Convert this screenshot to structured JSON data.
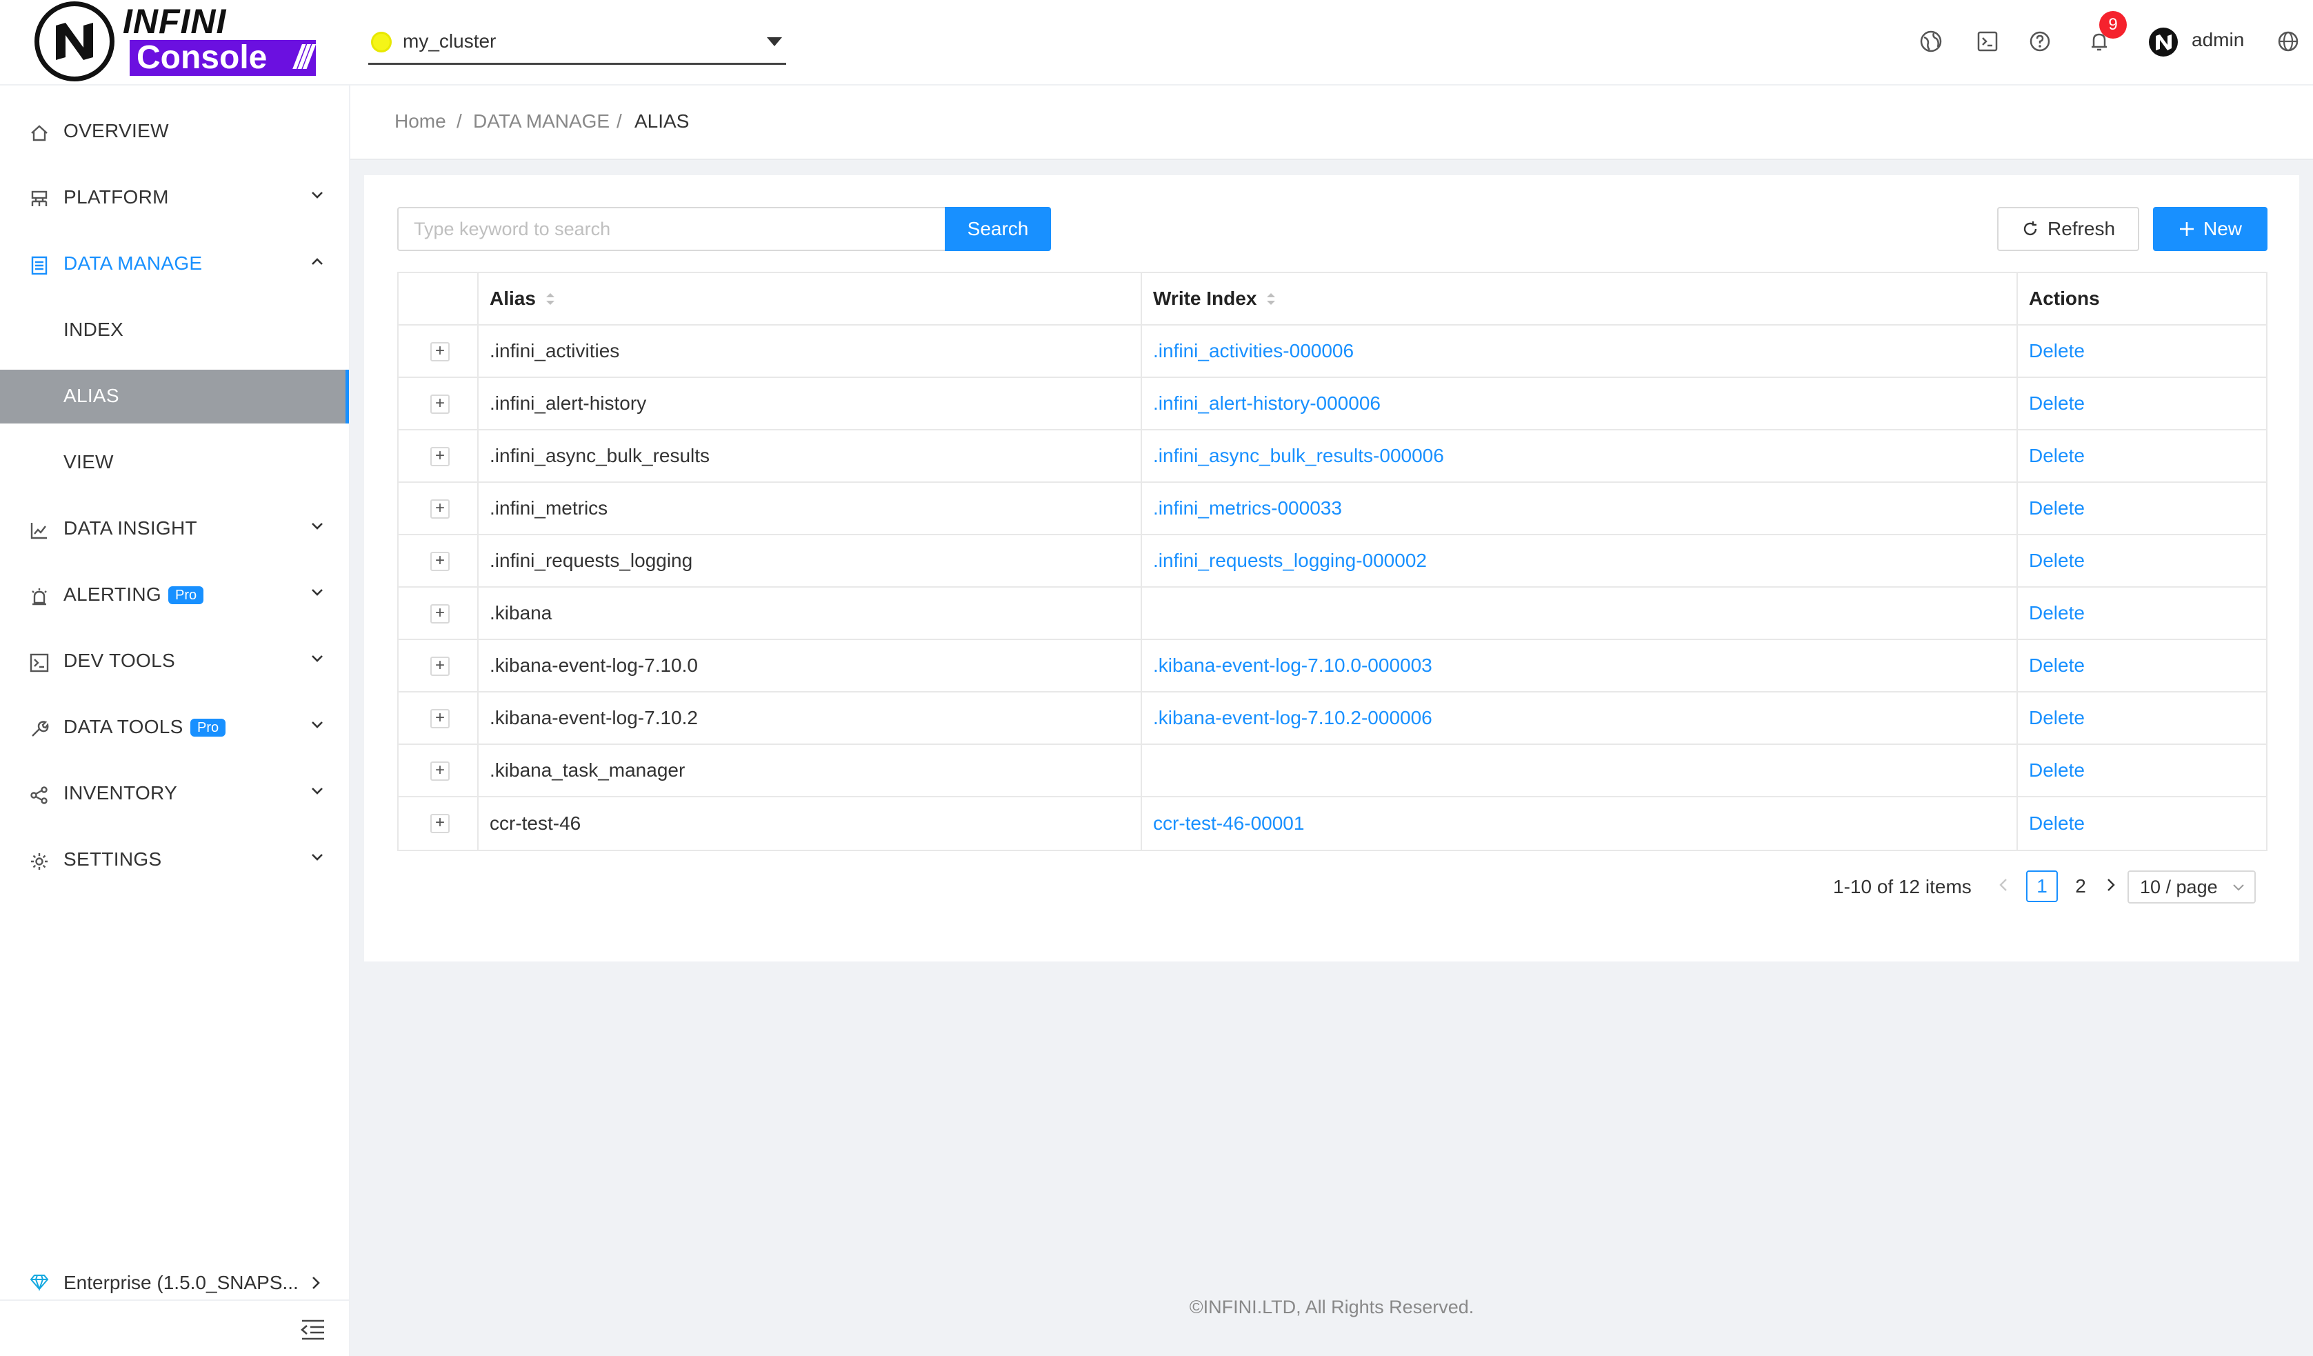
{
  "header": {
    "logo_top": "INFINI",
    "logo_bottom": "Console",
    "logo_slashes": "///",
    "cluster_name": "my_cluster",
    "notification_count": "9",
    "user_name": "admin"
  },
  "sidebar": {
    "items": [
      {
        "label": "OVERVIEW"
      },
      {
        "label": "PLATFORM"
      },
      {
        "label": "DATA MANAGE"
      },
      {
        "label": "INDEX"
      },
      {
        "label": "ALIAS"
      },
      {
        "label": "VIEW"
      },
      {
        "label": "DATA INSIGHT"
      },
      {
        "label": "ALERTING",
        "badge": "Pro"
      },
      {
        "label": "DEV TOOLS"
      },
      {
        "label": "DATA TOOLS",
        "badge": "Pro"
      },
      {
        "label": "INVENTORY"
      },
      {
        "label": "SETTINGS"
      }
    ],
    "edition": "Enterprise (1.5.0_SNAPS..."
  },
  "breadcrumb": [
    "Home",
    "DATA MANAGE",
    "ALIAS"
  ],
  "toolbar": {
    "search_placeholder": "Type keyword to search",
    "search_label": "Search",
    "refresh_label": "Refresh",
    "new_label": "New"
  },
  "table": {
    "columns": [
      "Alias",
      "Write Index",
      "Actions"
    ],
    "rows": [
      {
        "alias": ".infini_activities",
        "write_index": ".infini_activities-000006",
        "action": "Delete"
      },
      {
        "alias": ".infini_alert-history",
        "write_index": ".infini_alert-history-000006",
        "action": "Delete"
      },
      {
        "alias": ".infini_async_bulk_results",
        "write_index": ".infini_async_bulk_results-000006",
        "action": "Delete"
      },
      {
        "alias": ".infini_metrics",
        "write_index": ".infini_metrics-000033",
        "action": "Delete"
      },
      {
        "alias": ".infini_requests_logging",
        "write_index": ".infini_requests_logging-000002",
        "action": "Delete"
      },
      {
        "alias": ".kibana",
        "write_index": "",
        "action": "Delete"
      },
      {
        "alias": ".kibana-event-log-7.10.0",
        "write_index": ".kibana-event-log-7.10.0-000003",
        "action": "Delete"
      },
      {
        "alias": ".kibana-event-log-7.10.2",
        "write_index": ".kibana-event-log-7.10.2-000006",
        "action": "Delete"
      },
      {
        "alias": ".kibana_task_manager",
        "write_index": "",
        "action": "Delete"
      },
      {
        "alias": "ccr-test-46",
        "write_index": "ccr-test-46-00001",
        "action": "Delete"
      }
    ]
  },
  "pagination": {
    "total_text": "1-10 of 12 items",
    "pages": [
      "1",
      "2"
    ],
    "current_page": "1",
    "page_size": "10 / page"
  },
  "footer": "©INFINI.LTD, All Rights Reserved.",
  "colors": {
    "accent": "#1890ff",
    "brand": "#6b10e0",
    "selected_bg": "#9a9ea3",
    "badge": "#f5222d"
  }
}
